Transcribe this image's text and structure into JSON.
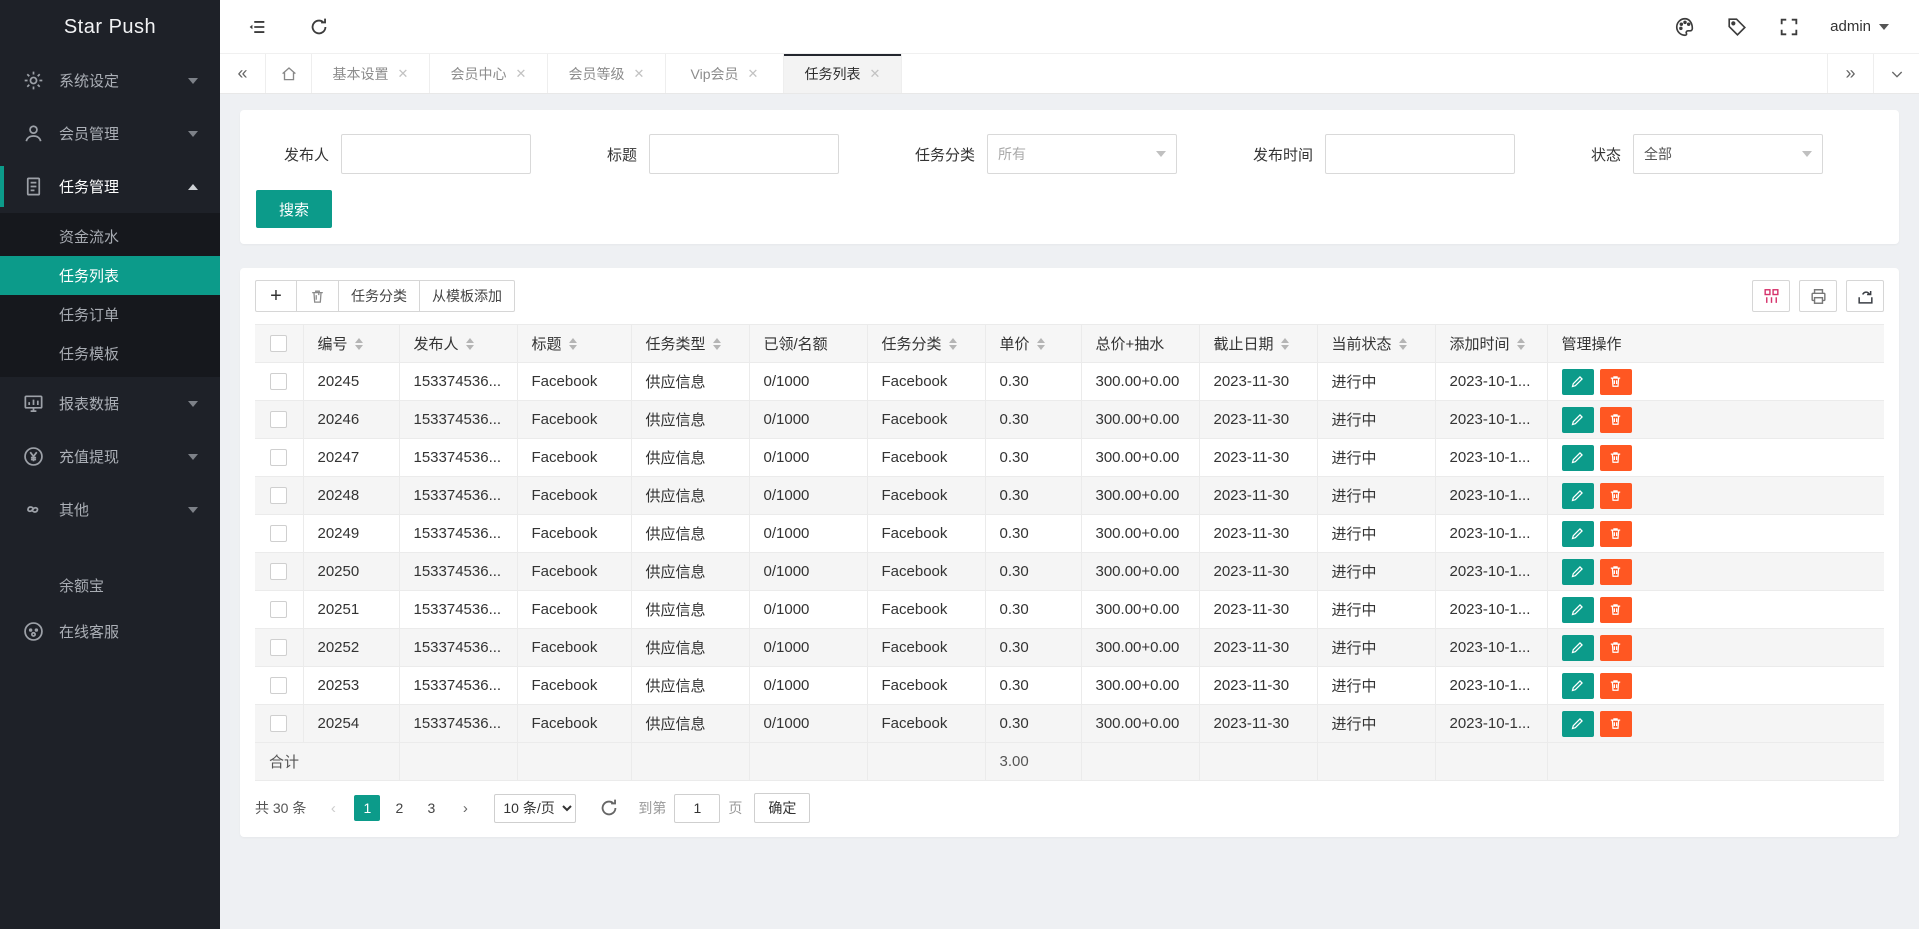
{
  "app": {
    "title": "Star Push",
    "user": "admin"
  },
  "sidebar": {
    "items": [
      {
        "label": "系统设定",
        "icon": "gear",
        "type": "parent",
        "caret": "down"
      },
      {
        "label": "会员管理",
        "icon": "user",
        "type": "parent",
        "caret": "down"
      },
      {
        "label": "任务管理",
        "icon": "document",
        "type": "parent",
        "caret": "up",
        "active": true
      },
      {
        "label": "资金流水",
        "type": "sub"
      },
      {
        "label": "任务列表",
        "type": "sub",
        "active": true
      },
      {
        "label": "任务订单",
        "type": "sub"
      },
      {
        "label": "任务模板",
        "type": "sub"
      },
      {
        "label": "报表数据",
        "icon": "board",
        "type": "parent",
        "caret": "down"
      },
      {
        "label": "充值提现",
        "icon": "yen",
        "type": "parent",
        "caret": "down"
      },
      {
        "label": "其他",
        "icon": "infinity",
        "type": "parent",
        "caret": "down"
      },
      {
        "label": "余额宝",
        "type": "sub",
        "caret": "down",
        "gap": true
      },
      {
        "label": "在线客服",
        "icon": "service",
        "type": "parent"
      }
    ]
  },
  "tabs": {
    "items": [
      {
        "label": "基本设置",
        "active": false
      },
      {
        "label": "会员中心",
        "active": false
      },
      {
        "label": "会员等级",
        "active": false
      },
      {
        "label": "Vip会员",
        "active": false
      },
      {
        "label": "任务列表",
        "active": true
      }
    ]
  },
  "search": {
    "fields": [
      {
        "label": "发布人",
        "type": "text",
        "value": ""
      },
      {
        "label": "标题",
        "type": "text",
        "value": ""
      },
      {
        "label": "任务分类",
        "type": "select",
        "value": "所有",
        "muted": true
      },
      {
        "label": "发布时间",
        "type": "text",
        "value": ""
      },
      {
        "label": "状态",
        "type": "select",
        "value": "全部",
        "muted": false
      }
    ],
    "submit_label": "搜索"
  },
  "toolbar": {
    "add_label": "+",
    "category_label": "任务分类",
    "from_template_label": "从模板添加"
  },
  "table": {
    "columns": [
      {
        "label": "编号",
        "sortable": true
      },
      {
        "label": "发布人",
        "sortable": true
      },
      {
        "label": "标题",
        "sortable": true
      },
      {
        "label": "任务类型",
        "sortable": true
      },
      {
        "label": "已领/名额",
        "sortable": false
      },
      {
        "label": "任务分类",
        "sortable": true
      },
      {
        "label": "单价",
        "sortable": true
      },
      {
        "label": "总价+抽水",
        "sortable": false
      },
      {
        "label": "截止日期",
        "sortable": true
      },
      {
        "label": "当前状态",
        "sortable": true
      },
      {
        "label": "添加时间",
        "sortable": true
      },
      {
        "label": "管理操作",
        "sortable": false
      }
    ],
    "rows": [
      [
        "20245",
        "153374536...",
        "Facebook",
        "供应信息",
        "0/1000",
        "Facebook",
        "0.30",
        "300.00+0.00",
        "2023-11-30",
        "进行中",
        "2023-10-1..."
      ],
      [
        "20246",
        "153374536...",
        "Facebook",
        "供应信息",
        "0/1000",
        "Facebook",
        "0.30",
        "300.00+0.00",
        "2023-11-30",
        "进行中",
        "2023-10-1..."
      ],
      [
        "20247",
        "153374536...",
        "Facebook",
        "供应信息",
        "0/1000",
        "Facebook",
        "0.30",
        "300.00+0.00",
        "2023-11-30",
        "进行中",
        "2023-10-1..."
      ],
      [
        "20248",
        "153374536...",
        "Facebook",
        "供应信息",
        "0/1000",
        "Facebook",
        "0.30",
        "300.00+0.00",
        "2023-11-30",
        "进行中",
        "2023-10-1..."
      ],
      [
        "20249",
        "153374536...",
        "Facebook",
        "供应信息",
        "0/1000",
        "Facebook",
        "0.30",
        "300.00+0.00",
        "2023-11-30",
        "进行中",
        "2023-10-1..."
      ],
      [
        "20250",
        "153374536...",
        "Facebook",
        "供应信息",
        "0/1000",
        "Facebook",
        "0.30",
        "300.00+0.00",
        "2023-11-30",
        "进行中",
        "2023-10-1..."
      ],
      [
        "20251",
        "153374536...",
        "Facebook",
        "供应信息",
        "0/1000",
        "Facebook",
        "0.30",
        "300.00+0.00",
        "2023-11-30",
        "进行中",
        "2023-10-1..."
      ],
      [
        "20252",
        "153374536...",
        "Facebook",
        "供应信息",
        "0/1000",
        "Facebook",
        "0.30",
        "300.00+0.00",
        "2023-11-30",
        "进行中",
        "2023-10-1..."
      ],
      [
        "20253",
        "153374536...",
        "Facebook",
        "供应信息",
        "0/1000",
        "Facebook",
        "0.30",
        "300.00+0.00",
        "2023-11-30",
        "进行中",
        "2023-10-1..."
      ],
      [
        "20254",
        "153374536...",
        "Facebook",
        "供应信息",
        "0/1000",
        "Facebook",
        "0.30",
        "300.00+0.00",
        "2023-11-30",
        "进行中",
        "2023-10-1..."
      ]
    ],
    "summary": {
      "label": "合计",
      "unit_price_total": "3.00"
    }
  },
  "pagination": {
    "total_label": "共 30 条",
    "pages": [
      "1",
      "2",
      "3"
    ],
    "active_page": "1",
    "page_size_label": "10 条/页",
    "jump_prefix": "到第",
    "jump_value": "1",
    "jump_suffix": "页",
    "confirm_label": "确定"
  },
  "colors": {
    "accent": "#0c9b8a",
    "danger": "#ff5722",
    "sidebar_bg": "#1e2128"
  }
}
